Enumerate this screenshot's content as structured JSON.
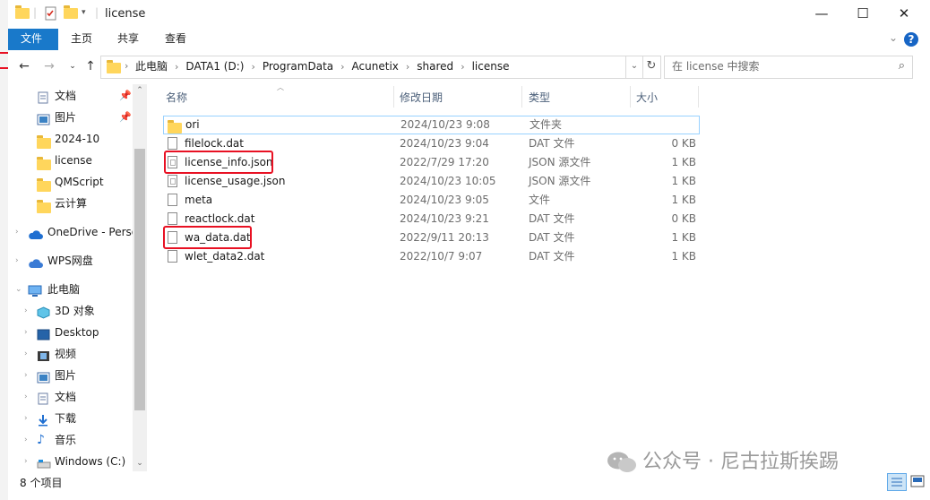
{
  "window": {
    "title": "license"
  },
  "ribbon": {
    "tabs": [
      "文件",
      "主页",
      "共享",
      "查看"
    ],
    "help_label": "?"
  },
  "address": {
    "crumbs": [
      "此电脑",
      "DATA1 (D:)",
      "ProgramData",
      "Acunetix",
      "shared",
      "license"
    ]
  },
  "search": {
    "placeholder": "在 license 中搜索"
  },
  "nav": {
    "quick_access": [
      {
        "label": "文档",
        "icon": "documents-icon",
        "pinned": true
      },
      {
        "label": "图片",
        "icon": "pictures-icon",
        "pinned": true
      },
      {
        "label": "2024-10",
        "icon": "folder-icon",
        "pinned": false
      },
      {
        "label": "license",
        "icon": "folder-icon",
        "pinned": false
      },
      {
        "label": "QMScript",
        "icon": "folder-icon",
        "pinned": false
      },
      {
        "label": "云计算",
        "icon": "folder-icon",
        "pinned": false
      }
    ],
    "onedrive": "OneDrive - Perso",
    "wps": "WPS网盘",
    "this_pc": "此电脑",
    "pc_items": [
      {
        "label": "3D 对象",
        "icon": "3d-objects-icon"
      },
      {
        "label": "Desktop",
        "icon": "desktop-icon"
      },
      {
        "label": "视频",
        "icon": "videos-icon"
      },
      {
        "label": "图片",
        "icon": "pictures-icon"
      },
      {
        "label": "文档",
        "icon": "documents-icon"
      },
      {
        "label": "下载",
        "icon": "downloads-icon"
      },
      {
        "label": "音乐",
        "icon": "music-icon"
      },
      {
        "label": "Windows (C:)",
        "icon": "drive-icon"
      }
    ]
  },
  "columns": {
    "name": "名称",
    "date": "修改日期",
    "type": "类型",
    "size": "大小"
  },
  "files": [
    {
      "name": "ori",
      "date": "2024/10/23 9:08",
      "type": "文件夹",
      "size": "",
      "kind": "folder"
    },
    {
      "name": "filelock.dat",
      "date": "2024/10/23 9:04",
      "type": "DAT 文件",
      "size": "0 KB",
      "kind": "file"
    },
    {
      "name": "license_info.json",
      "date": "2022/7/29 17:20",
      "type": "JSON 源文件",
      "size": "1 KB",
      "kind": "json"
    },
    {
      "name": "license_usage.json",
      "date": "2024/10/23 10:05",
      "type": "JSON 源文件",
      "size": "1 KB",
      "kind": "json"
    },
    {
      "name": "meta",
      "date": "2024/10/23 9:05",
      "type": "文件",
      "size": "1 KB",
      "kind": "file"
    },
    {
      "name": "reactlock.dat",
      "date": "2024/10/23 9:21",
      "type": "DAT 文件",
      "size": "0 KB",
      "kind": "file"
    },
    {
      "name": "wa_data.dat",
      "date": "2022/9/11 20:13",
      "type": "DAT 文件",
      "size": "1 KB",
      "kind": "file"
    },
    {
      "name": "wlet_data2.dat",
      "date": "2022/10/7 9:07",
      "type": "DAT 文件",
      "size": "1 KB",
      "kind": "file"
    }
  ],
  "status": {
    "count": "8 个项目"
  },
  "watermark": "公众号 · 尼古拉斯挨踢",
  "colors": {
    "accent": "#1979ca",
    "highlight": "#e81123",
    "selection_border": "#99d1ff"
  }
}
